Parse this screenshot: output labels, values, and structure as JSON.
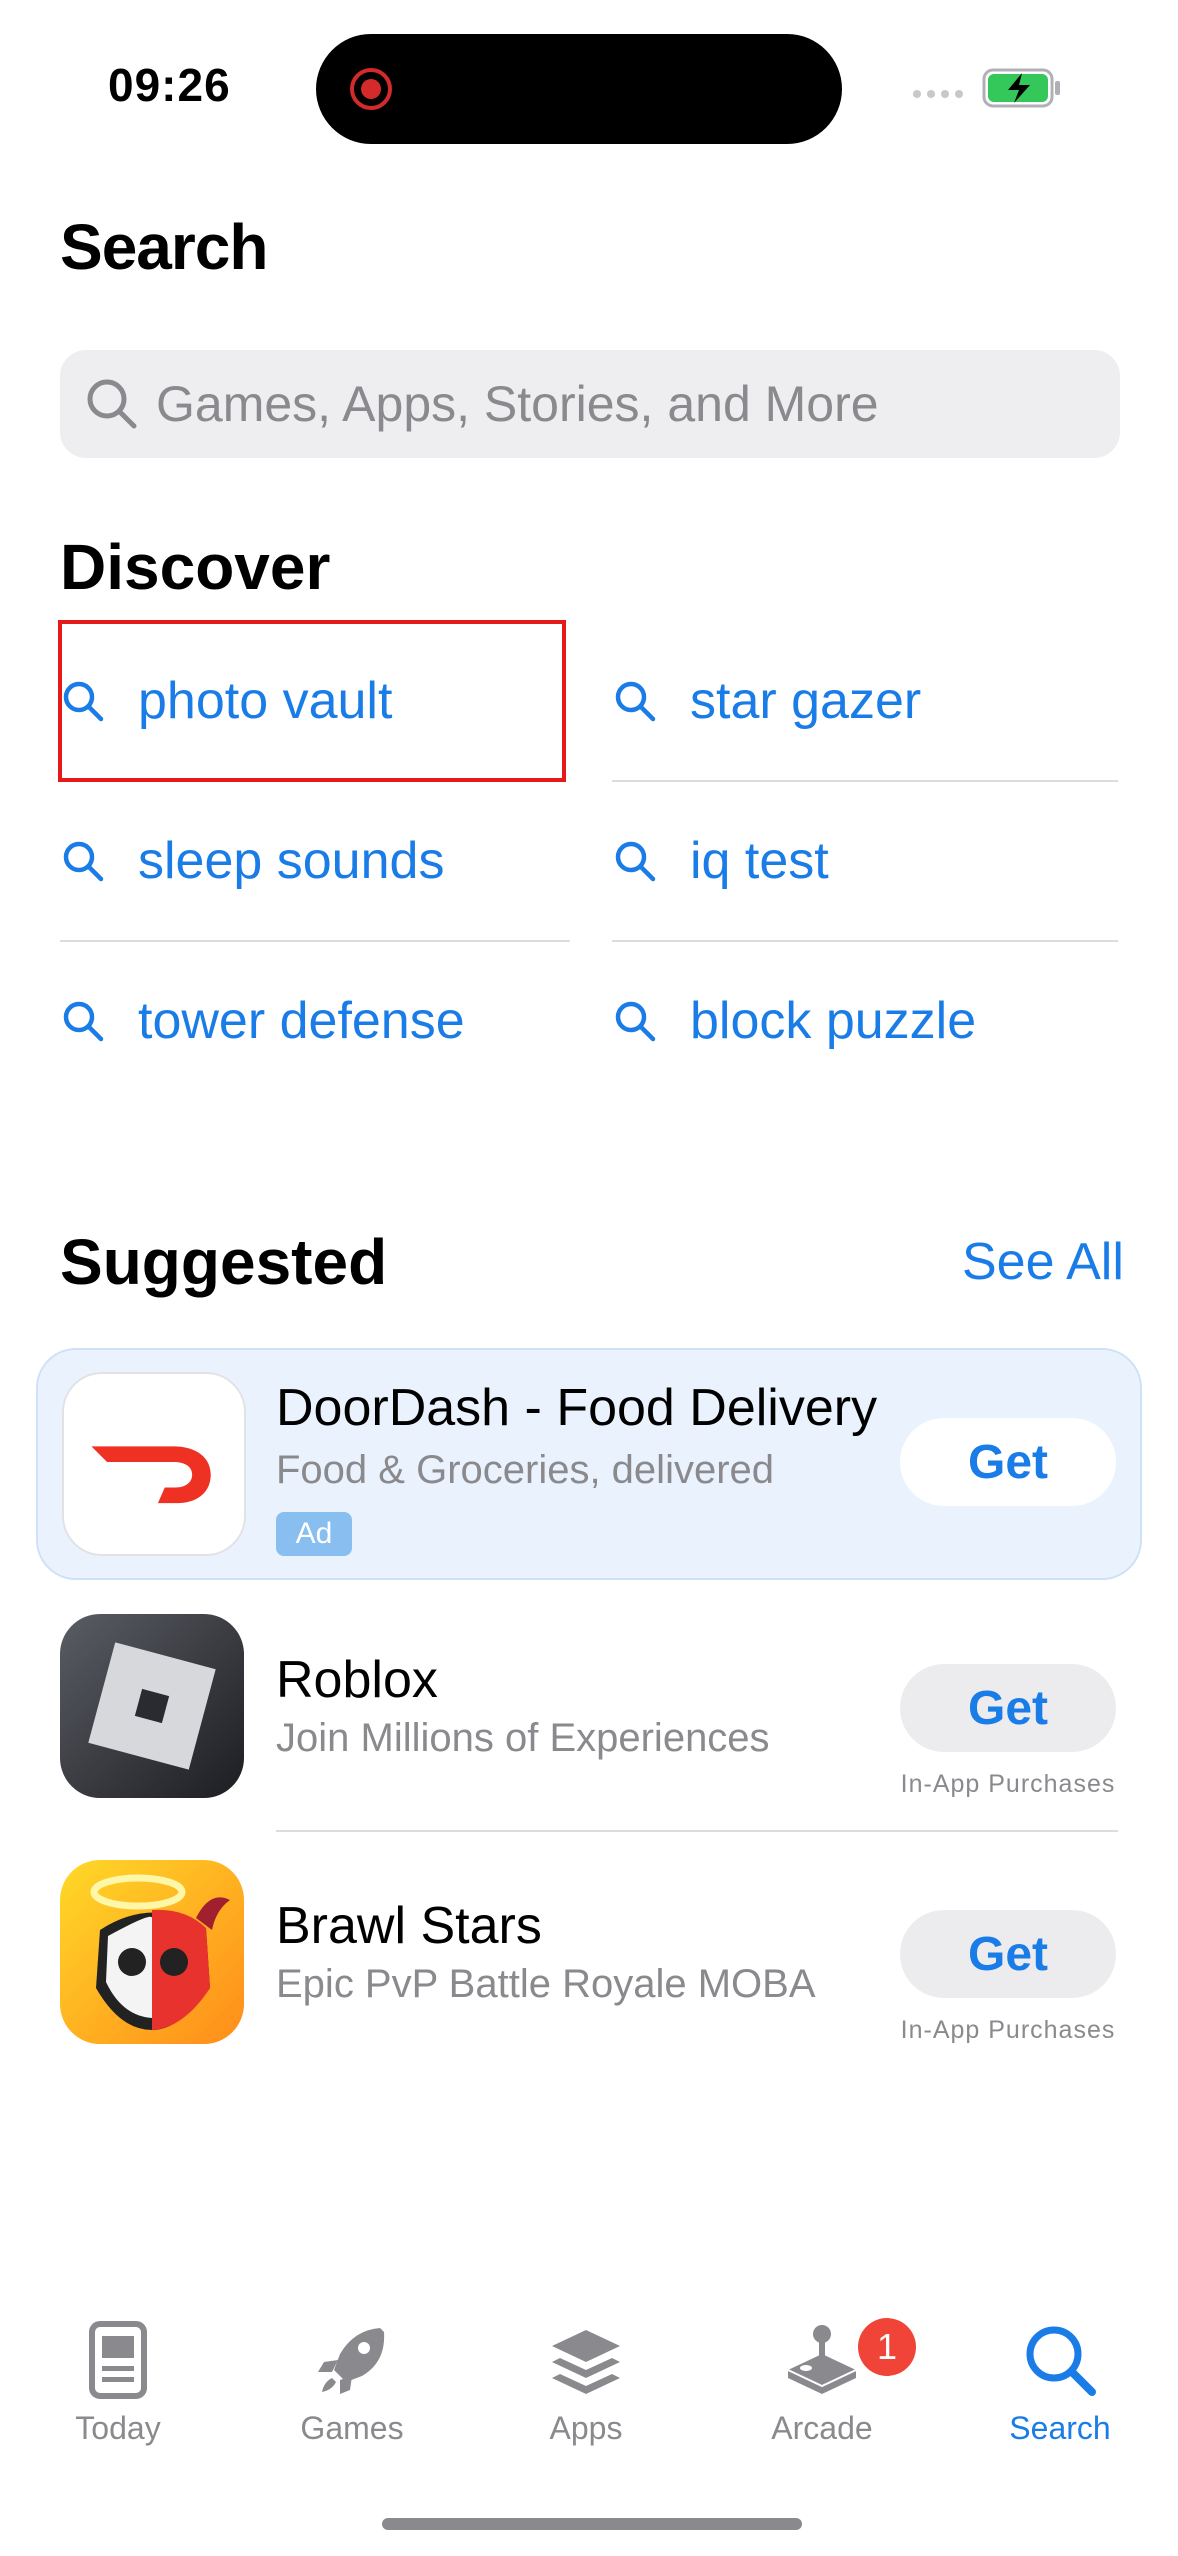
{
  "status_bar": {
    "time": "09:26"
  },
  "page": {
    "title": "Search"
  },
  "search": {
    "placeholder": "Games, Apps, Stories, and More"
  },
  "discover": {
    "title": "Discover",
    "items": [
      "photo vault",
      "star gazer",
      "sleep sounds",
      "iq test",
      "tower defense",
      "block puzzle"
    ]
  },
  "suggested": {
    "title": "Suggested",
    "see_all": "See All",
    "apps": [
      {
        "name": "DoorDash - Food Delivery",
        "subtitle": "Food & Groceries, delivered",
        "badge": "Ad",
        "button": "Get",
        "note": ""
      },
      {
        "name": "Roblox",
        "subtitle": "Join Millions of Experiences",
        "button": "Get",
        "note": "In-App Purchases"
      },
      {
        "name": "Brawl Stars",
        "subtitle": "Epic PvP Battle Royale MOBA",
        "button": "Get",
        "note": "In-App Purchases"
      }
    ]
  },
  "tabs": [
    {
      "label": "Today",
      "icon": "today-icon"
    },
    {
      "label": "Games",
      "icon": "rocket-icon"
    },
    {
      "label": "Apps",
      "icon": "layers-icon"
    },
    {
      "label": "Arcade",
      "icon": "joystick-icon",
      "badge": "1"
    },
    {
      "label": "Search",
      "icon": "search-icon",
      "active": true
    }
  ],
  "colors": {
    "accent": "#1a7ce6",
    "highlight_box": "#e31b1b",
    "badge": "#f04438"
  }
}
